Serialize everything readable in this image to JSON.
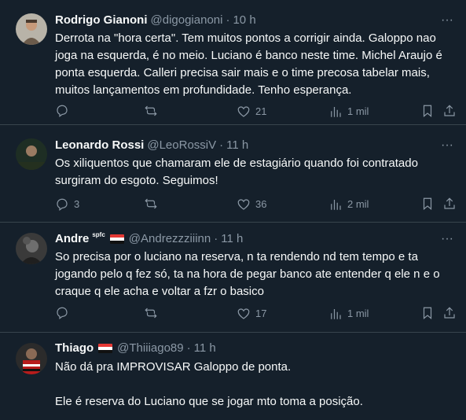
{
  "tweets": [
    {
      "name": "Rodrigo Gianoni",
      "handle": "@digogianoni",
      "dot": "·",
      "time": "10 h",
      "text": "Derrota na \"hora certa\". Tem muitos pontos a corrigir ainda. Galoppo nao joga na esquerda, é no meio. Luciano é banco neste time. Michel Araujo é ponta esquerda. Calleri precisa sair mais e o time precosa tabelar mais, muitos lançamentos em profundidade. Tenho esperança.",
      "replies": "",
      "retweets": "",
      "likes": "21",
      "views": "1 mil"
    },
    {
      "name": "Leonardo Rossi",
      "handle": "@LeoRossiV",
      "dot": "·",
      "time": "11 h",
      "text": "Os xiliquentos que chamaram ele de estagiário quando foi contratado surgiram do esgoto. Seguimos!",
      "replies": "3",
      "retweets": "",
      "likes": "36",
      "views": "2 mil"
    },
    {
      "name": "Andre",
      "name_badge": "spfc",
      "handle": "@Andrezzziiinn",
      "dot": "·",
      "time": "11 h",
      "text": "So precisa por o luciano na reserva, n ta rendendo nd tem tempo e ta jogando pelo q fez só, ta na hora de pegar banco ate entender q ele n e o craque q ele acha e voltar a fzr o basico",
      "replies": "",
      "retweets": "",
      "likes": "17",
      "views": "1 mil"
    },
    {
      "name": "Thiago",
      "handle": "@Thiiiago89",
      "dot": "·",
      "time": "11 h",
      "text": "Não dá pra IMPROVISAR Galoppo de ponta.\n\nEle é reserva do Luciano que se jogar mto toma a posição."
    }
  ],
  "colors": {
    "background": "#15202b",
    "text": "#f7f9f9",
    "secondary": "#8b98a5",
    "divider": "#38444d"
  },
  "icons": [
    "more-icon",
    "reply-icon",
    "retweet-icon",
    "like-icon",
    "views-icon",
    "bookmark-icon",
    "share-icon",
    "flag-icon"
  ]
}
